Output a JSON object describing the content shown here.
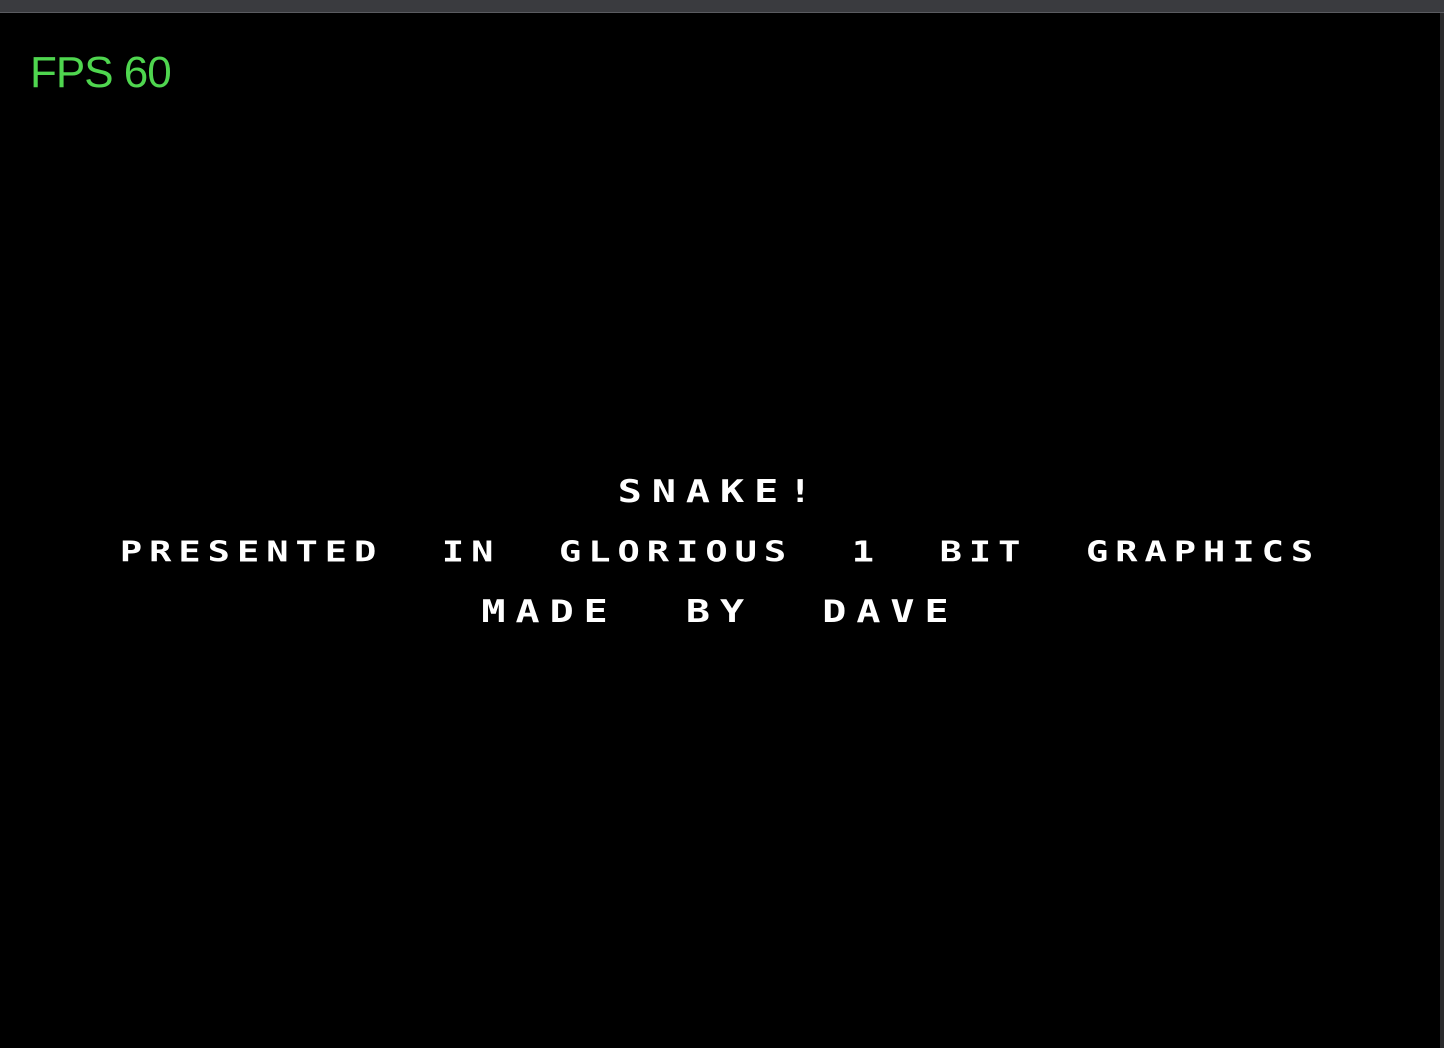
{
  "hud": {
    "fps_text": "FPS 60",
    "fps_color": "#4fd64f"
  },
  "title_screen": {
    "title": "SNAKE!",
    "subtitle": "PRESENTED  IN  GLORIOUS  1  BIT  GRAPHICS",
    "credit": "MADE  BY  DAVE",
    "text_color": "#ffffff",
    "background_color": "#000000"
  }
}
